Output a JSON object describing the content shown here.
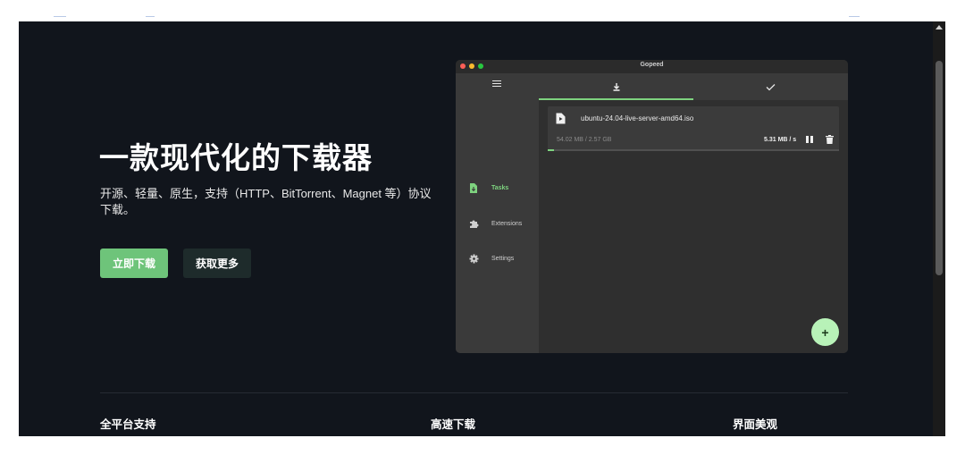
{
  "hero": {
    "title": "一款现代化的下载器",
    "description": "开源、轻量、原生，支持（HTTP、BitTorrent、Magnet 等）协议下载。",
    "primary_button": "立即下载",
    "secondary_button": "获取更多"
  },
  "app": {
    "window_title": "Gopeed",
    "sidebar": {
      "items": [
        {
          "label": "Tasks",
          "icon": "file-download-icon",
          "active": true
        },
        {
          "label": "Extensions",
          "icon": "puzzle-icon",
          "active": false
        },
        {
          "label": "Settings",
          "icon": "gear-icon",
          "active": false
        }
      ]
    },
    "tabs": [
      {
        "icon": "download-icon",
        "active": true
      },
      {
        "icon": "checkmark-icon",
        "active": false
      }
    ],
    "task": {
      "filename": "ubuntu-24.04-live-server-amd64.iso",
      "size": "54.02 MB / 2.57 GB",
      "speed": "5.31 MB / s",
      "progress": 0.021
    }
  },
  "features": [
    {
      "title": "全平台支持"
    },
    {
      "title": "高速下载"
    },
    {
      "title": "界面美观"
    }
  ],
  "colors": {
    "background": "#11151c",
    "accent": "#6ec47a",
    "app_accent": "#7ed37f",
    "fab": "#b8f2b8"
  }
}
